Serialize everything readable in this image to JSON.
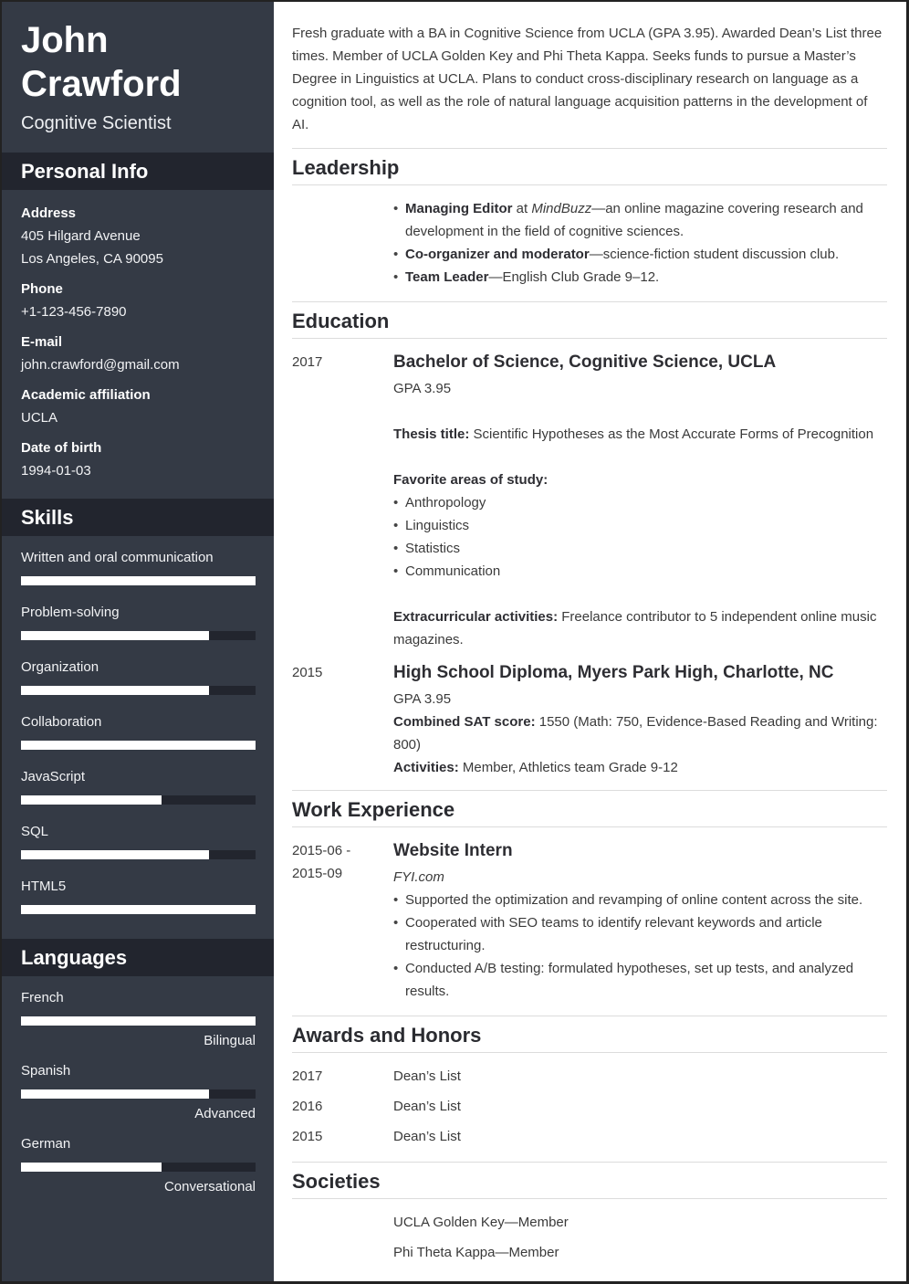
{
  "header": {
    "first_name": "John",
    "last_name": "Crawford",
    "job_title": "Cognitive Scientist"
  },
  "personal_info": {
    "heading": "Personal Info",
    "fields": [
      {
        "label": "Address",
        "lines": [
          "405 Hilgard Avenue",
          "Los Angeles, CA 90095"
        ]
      },
      {
        "label": "Phone",
        "lines": [
          "+1-123-456-7890"
        ]
      },
      {
        "label": "E-mail",
        "lines": [
          "john.crawford@gmail.com"
        ]
      },
      {
        "label": "Academic affiliation",
        "lines": [
          "UCLA"
        ]
      },
      {
        "label": "Date of birth",
        "lines": [
          "1994-01-03"
        ]
      }
    ]
  },
  "skills": {
    "heading": "Skills",
    "items": [
      {
        "name": "Written and oral communication",
        "level": 1.0
      },
      {
        "name": "Problem-solving",
        "level": 0.8
      },
      {
        "name": "Organization",
        "level": 0.8
      },
      {
        "name": "Collaboration",
        "level": 1.0
      },
      {
        "name": "JavaScript",
        "level": 0.6
      },
      {
        "name": "SQL",
        "level": 0.8
      },
      {
        "name": "HTML5",
        "level": 1.0
      }
    ]
  },
  "languages": {
    "heading": "Languages",
    "items": [
      {
        "name": "French",
        "level": 1.0,
        "level_label": "Bilingual"
      },
      {
        "name": "Spanish",
        "level": 0.8,
        "level_label": "Advanced"
      },
      {
        "name": "German",
        "level": 0.6,
        "level_label": "Conversational"
      }
    ]
  },
  "summary": "Fresh graduate with a BA in Cognitive Science from UCLA (GPA 3.95). Awarded Dean’s List three times. Member of UCLA Golden Key and Phi Theta Kappa. Seeks funds to pursue a Master’s Degree in Linguistics at UCLA. Plans to conduct cross-disciplinary research on language as a cognition tool, as well as the role of natural language acquisition patterns in the development of AI.",
  "leadership": {
    "heading": "Leadership",
    "items": [
      {
        "bold": "Managing Editor",
        "middle": " at ",
        "italic": "MindBuzz",
        "rest": "—an online magazine covering research and development in the field of cognitive sciences."
      },
      {
        "bold": "Co-organizer and moderator",
        "middle": "",
        "italic": "",
        "rest": "—science-fiction student discussion club."
      },
      {
        "bold": "Team Leader",
        "middle": "",
        "italic": "",
        "rest": "—English Club Grade 9–12."
      }
    ]
  },
  "education": {
    "heading": "Education",
    "entries": [
      {
        "date": "2017",
        "title": "Bachelor of Science, Cognitive Science, UCLA",
        "gpa": "GPA 3.95",
        "thesis_label": "Thesis title:",
        "thesis": " Scientific Hypotheses as the Most Accurate Forms of Precognition",
        "areas_label": "Favorite areas of study:",
        "areas": [
          "Anthropology",
          "Linguistics",
          "Statistics",
          "Communication"
        ],
        "extra_label": "Extracurricular activities:",
        "extra": " Freelance contributor to 5 independent online music magazines."
      },
      {
        "date": "2015",
        "title": "High School Diploma, Myers Park High, Charlotte, NC",
        "gpa": "GPA 3.95",
        "sat_label": "Combined SAT score:",
        "sat": " 1550 (Math: 750, Evidence-Based Reading and Writing: 800)",
        "activities_label": "Activities:",
        "activities": " Member, Athletics team Grade 9-12"
      }
    ]
  },
  "work": {
    "heading": "Work Experience",
    "entries": [
      {
        "date_start": "2015-06 -",
        "date_end": "2015-09",
        "title": "Website Intern",
        "company": "FYI.com",
        "bullets": [
          "Supported the optimization and revamping of online content across the site.",
          "Cooperated with SEO teams to identify relevant keywords and article restructuring.",
          "Conducted A/B testing: formulated hypotheses, set up tests, and analyzed results."
        ]
      }
    ]
  },
  "awards": {
    "heading": "Awards and Honors",
    "items": [
      {
        "year": "2017",
        "name": "Dean’s List"
      },
      {
        "year": "2016",
        "name": "Dean’s List"
      },
      {
        "year": "2015",
        "name": "Dean’s List"
      }
    ]
  },
  "societies": {
    "heading": "Societies",
    "items": [
      "UCLA Golden Key—Member",
      "Phi Theta Kappa—Member"
    ]
  },
  "colors": {
    "sidebar_bg": "#343a45",
    "sidebar_band": "#22252e",
    "bar_fill": "#ffffff",
    "bar_track": "#22252e",
    "divider": "#dcdcdc"
  }
}
